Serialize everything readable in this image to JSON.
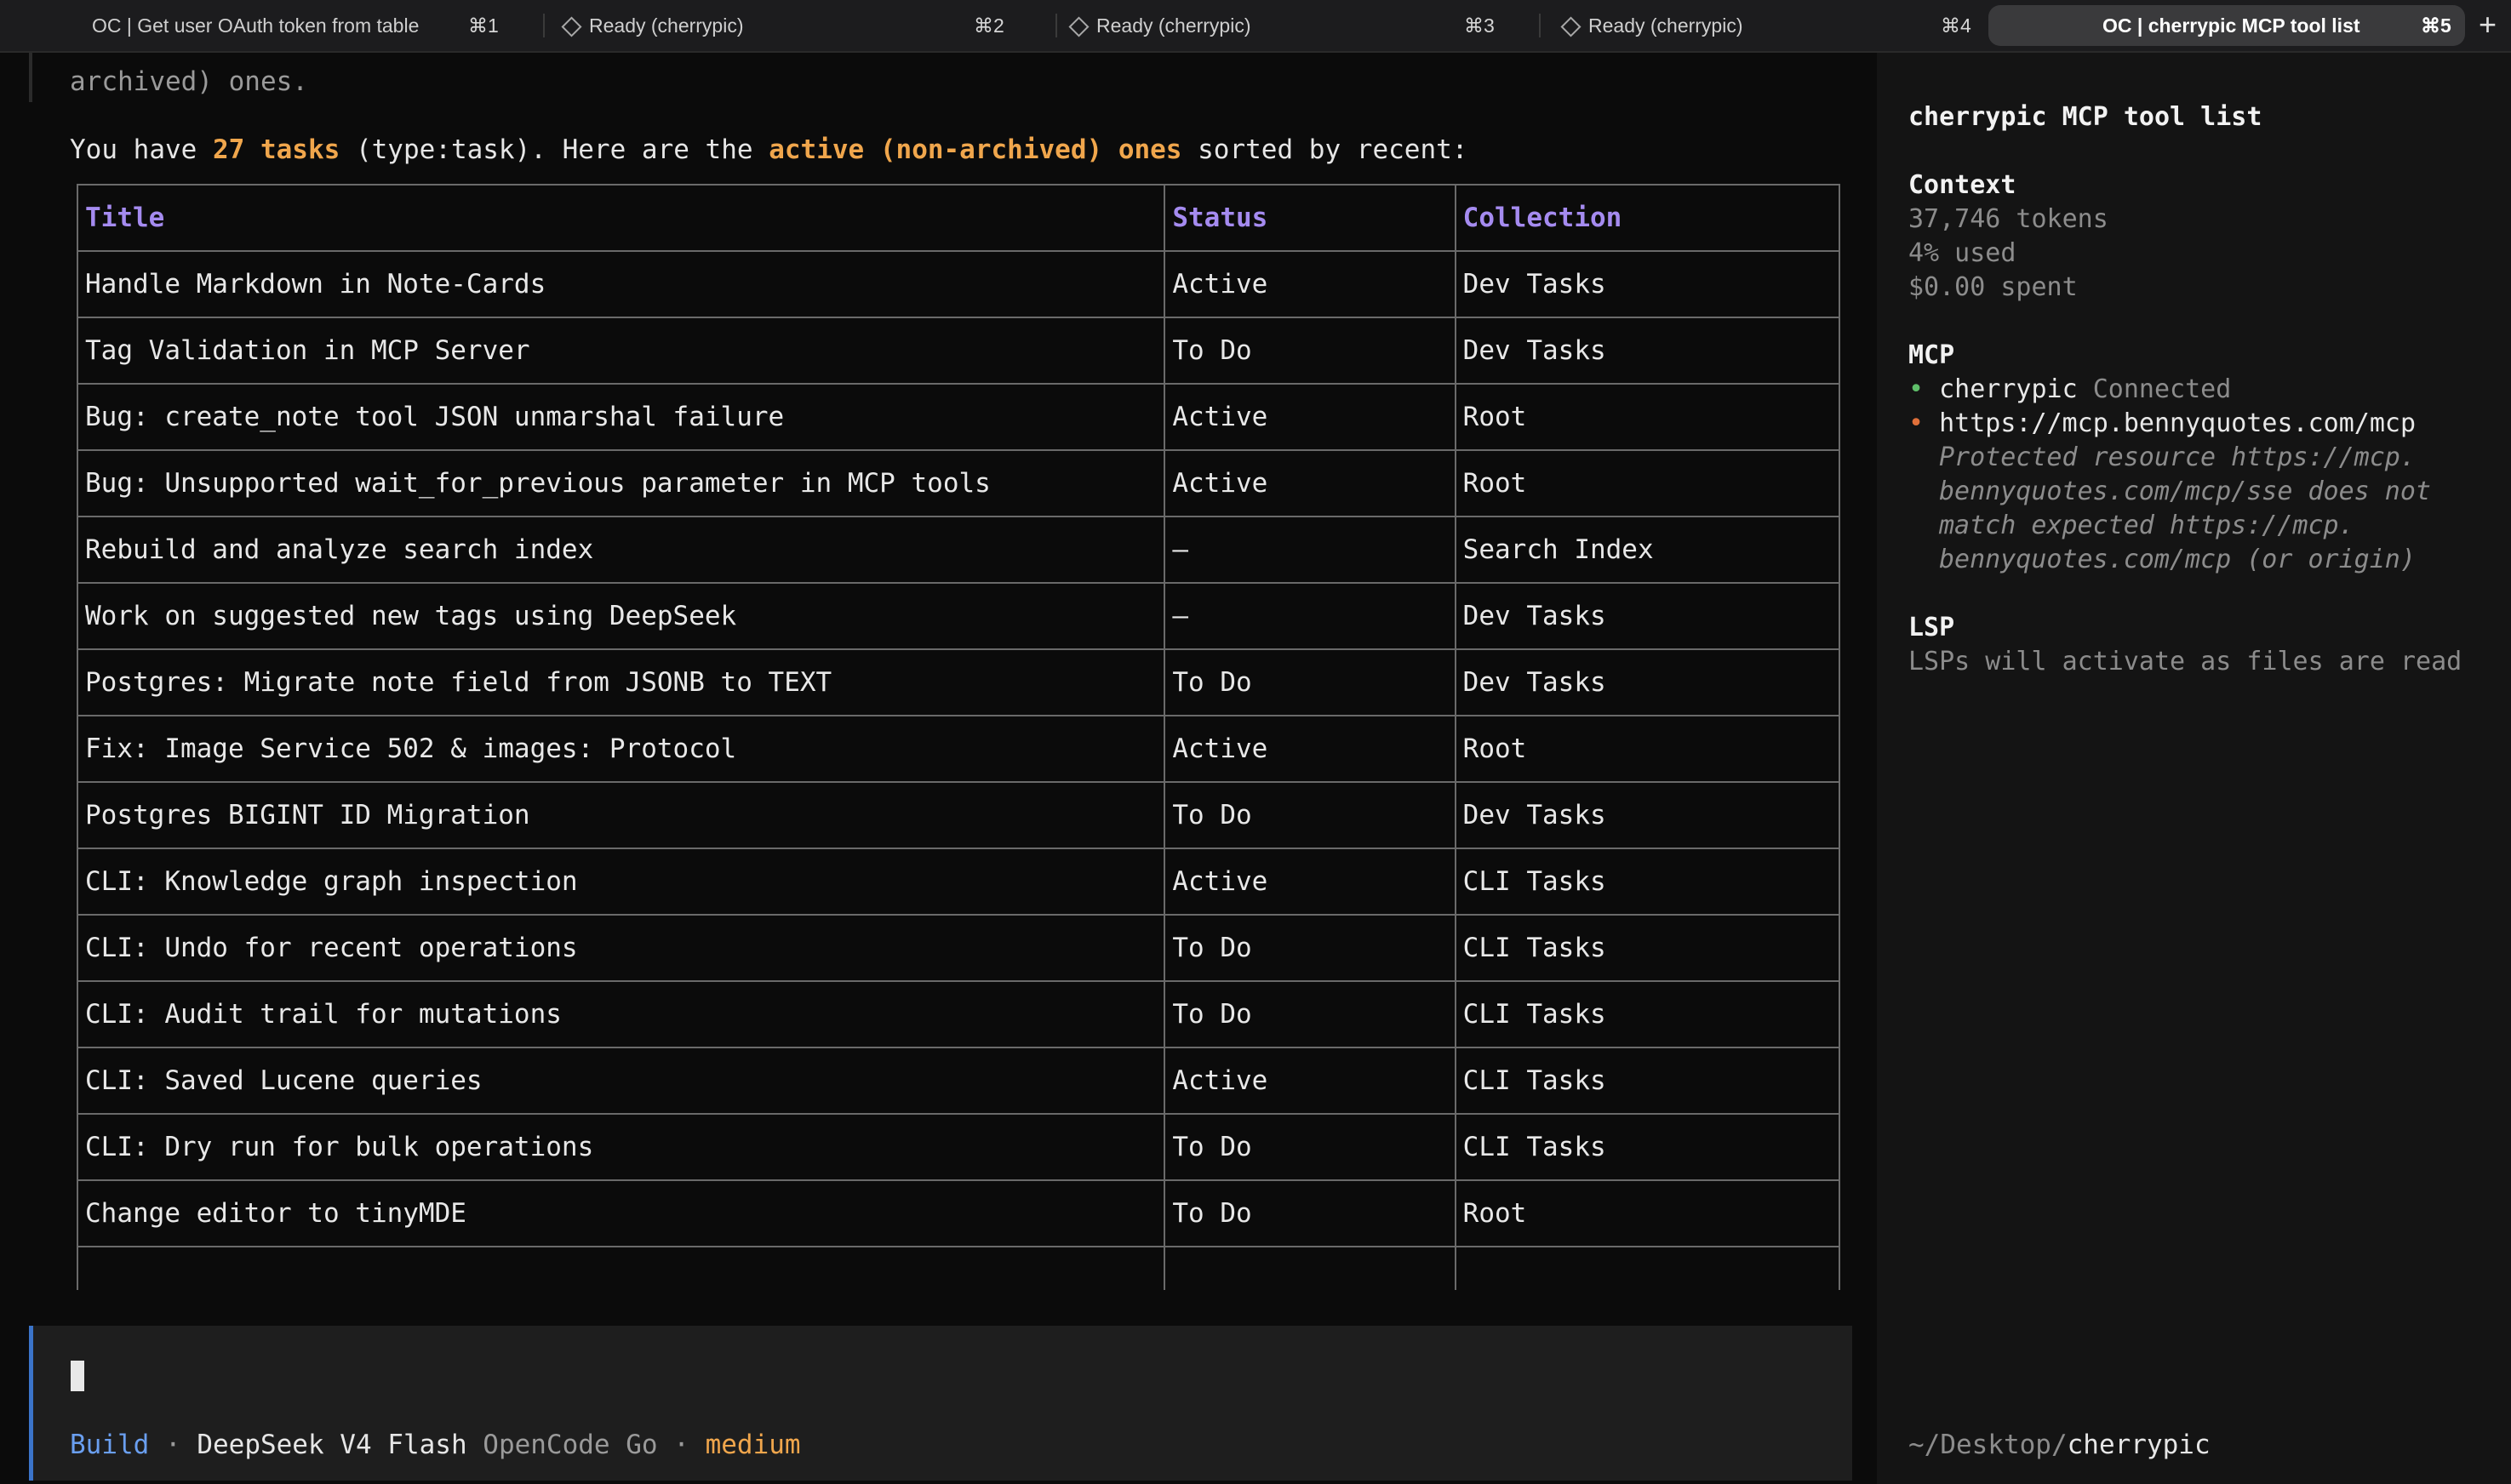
{
  "tabs": [
    {
      "label": "OC | Get user OAuth token from table",
      "shortcut": "⌘1",
      "icon": null,
      "active": false
    },
    {
      "label": "Ready (cherrypic)",
      "shortcut": "⌘2",
      "icon": "diamond-icon",
      "active": false
    },
    {
      "label": "Ready (cherrypic)",
      "shortcut": "⌘3",
      "icon": "diamond-icon",
      "active": false
    },
    {
      "label": "Ready (cherrypic)",
      "shortcut": "⌘4",
      "icon": "diamond-icon",
      "active": false
    },
    {
      "label": "OC | cherrypic MCP tool list",
      "shortcut": "⌘5",
      "icon": null,
      "active": true
    }
  ],
  "new_tab_label": "+",
  "chat": {
    "prev_line": "archived) ones.",
    "intro": {
      "p1": "You have ",
      "count": "27 tasks",
      "p2": " (type:task). Here are the ",
      "active": "active (non-archived) ones",
      "p3": " sorted by recent:"
    },
    "table": {
      "headers": [
        "Title",
        "Status",
        "Collection"
      ],
      "rows": [
        [
          "Handle Markdown in Note-Cards",
          "Active",
          "Dev Tasks"
        ],
        [
          "Tag Validation in MCP Server",
          "To Do",
          "Dev Tasks"
        ],
        [
          "Bug: create_note tool JSON unmarshal failure",
          "Active",
          "Root"
        ],
        [
          "Bug: Unsupported wait_for_previous parameter in MCP tools",
          "Active",
          "Root"
        ],
        [
          "Rebuild and analyze search index",
          "—",
          "Search Index"
        ],
        [
          "Work on suggested new tags using DeepSeek",
          "—",
          "Dev Tasks"
        ],
        [
          "Postgres: Migrate note field from JSONB to TEXT",
          "To Do",
          "Dev Tasks"
        ],
        [
          "Fix: Image Service 502 & images: Protocol",
          "Active",
          "Root"
        ],
        [
          "Postgres BIGINT ID Migration",
          "To Do",
          "Dev Tasks"
        ],
        [
          "CLI: Knowledge graph inspection",
          "Active",
          "CLI Tasks"
        ],
        [
          "CLI: Undo for recent operations",
          "To Do",
          "CLI Tasks"
        ],
        [
          "CLI: Audit trail for mutations",
          "To Do",
          "CLI Tasks"
        ],
        [
          "CLI: Saved Lucene queries",
          "Active",
          "CLI Tasks"
        ],
        [
          "CLI: Dry run for bulk operations",
          "To Do",
          "CLI Tasks"
        ],
        [
          "Change editor to tinyMDE",
          "To Do",
          "Root"
        ],
        [
          "",
          "",
          ""
        ]
      ]
    }
  },
  "statusbar": {
    "mode": "Build",
    "sep": " · ",
    "model": "DeepSeek V4 Flash",
    "provider": "OpenCode Go",
    "effort": "medium"
  },
  "sidebar": {
    "title": "cherrypic MCP tool list",
    "context_heading": "Context",
    "tokens": "37,746 tokens",
    "used": "4% used",
    "spent": "$0.00 spent",
    "mcp_heading": "MCP",
    "mcp_items": [
      {
        "name": "cherrypic",
        "status": "Connected"
      },
      {
        "name": "https://mcp.bennyquotes.com/mcp",
        "status": ""
      }
    ],
    "mcp_error_lines": [
      "Protected resource https://mcp.",
      "bennyquotes.com/mcp/sse does not",
      "match expected https://mcp.",
      "bennyquotes.com/mcp (or origin)"
    ],
    "lsp_heading": "LSP",
    "lsp_text": "LSPs will activate as files are read",
    "cwd_prefix": "~/Desktop/",
    "cwd_dir": "cherrypic"
  },
  "colors": {
    "accent_blue": "#6a9ff0",
    "accent_orange": "#f0a64c",
    "header_purple": "#a58bf0",
    "connected_green": "#5fbf6a",
    "error_orange": "#e0703a"
  }
}
